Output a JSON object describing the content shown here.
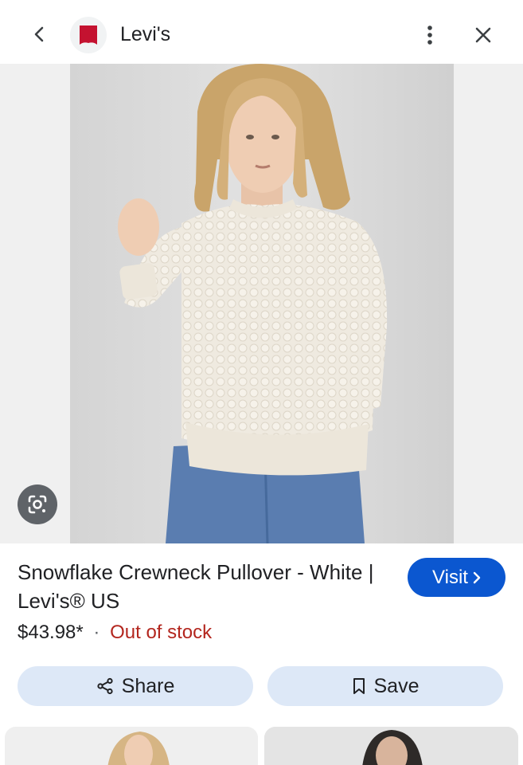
{
  "header": {
    "back_icon": "chevron-left-icon",
    "site_name": "Levi's",
    "more_icon": "more-vert-icon",
    "close_icon": "close-icon"
  },
  "image": {
    "lens_icon": "google-lens-icon"
  },
  "product": {
    "title": "Snowflake Crewneck Pullover - White | Levi's® US",
    "price": "$43.98*",
    "separator": "·",
    "stock": "Out of stock",
    "visit_label": "Visit",
    "visit_icon": "chevron-right-icon"
  },
  "actions": {
    "share_label": "Share",
    "share_icon": "share-icon",
    "save_label": "Save",
    "save_icon": "bookmark-icon"
  },
  "colors": {
    "brand_red": "#c41230",
    "visit_blue": "#0b57d0",
    "stock_red": "#b3261e",
    "button_bg": "#dde8f7"
  }
}
